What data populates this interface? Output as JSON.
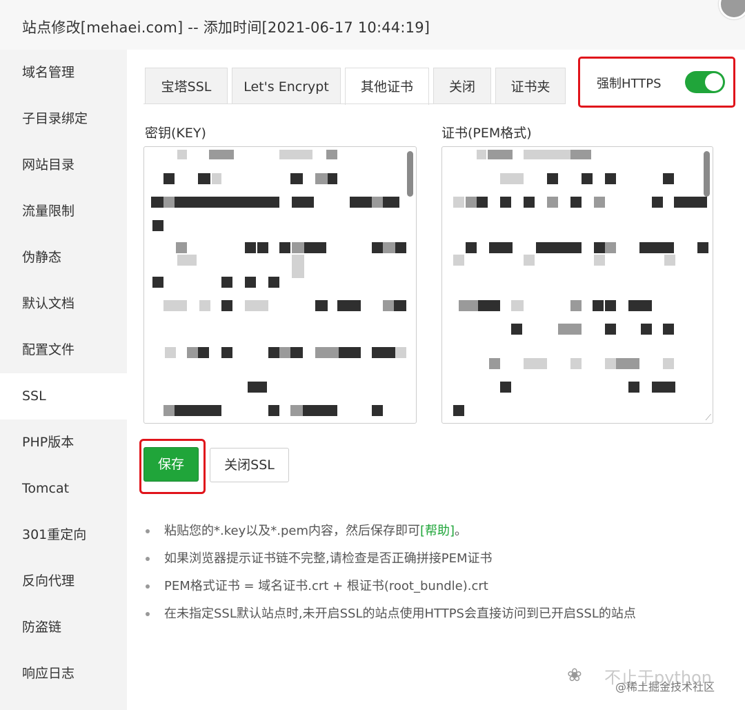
{
  "window": {
    "title": "站点修改[mehaei.com] -- 添加时间[2021-06-17 10:44:19]"
  },
  "sidebar": {
    "items": [
      {
        "label": "域名管理"
      },
      {
        "label": "子目录绑定"
      },
      {
        "label": "网站目录"
      },
      {
        "label": "流量限制"
      },
      {
        "label": "伪静态"
      },
      {
        "label": "默认文档"
      },
      {
        "label": "配置文件"
      },
      {
        "label": "SSL",
        "active": true
      },
      {
        "label": "PHP版本"
      },
      {
        "label": "Tomcat"
      },
      {
        "label": "301重定向"
      },
      {
        "label": "反向代理"
      },
      {
        "label": "防盗链"
      },
      {
        "label": "响应日志"
      }
    ]
  },
  "tabs": [
    {
      "label": "宝塔SSL"
    },
    {
      "label": "Let's Encrypt"
    },
    {
      "label": "其他证书",
      "active": true
    },
    {
      "label": "关闭"
    },
    {
      "label": "证书夹"
    }
  ],
  "force_https": {
    "label": "强制HTTPS",
    "enabled": true
  },
  "fields": {
    "key_label": "密钥(KEY)",
    "pem_label": "证书(PEM格式)"
  },
  "buttons": {
    "save": "保存",
    "close_ssl": "关闭SSL"
  },
  "tips": {
    "tip1_text": "粘贴您的*.key以及*.pem内容，然后保存即可",
    "tip1_link": "[帮助]",
    "tip1_end": "。",
    "tip2": "如果浏览器提示证书链不完整,请检查是否正确拼接PEM证书",
    "tip3": "PEM格式证书 = 域名证书.crt + 根证书(root_bundle).crt",
    "tip4": "在未指定SSL默认站点时,未开启SSL的站点使用HTTPS会直接访问到已开启SSL的站点"
  },
  "watermark": {
    "main": "不止于python",
    "sub": "@稀土掘金技术社区"
  },
  "colors": {
    "accent": "#20a53a",
    "highlight": "#e0141b"
  }
}
